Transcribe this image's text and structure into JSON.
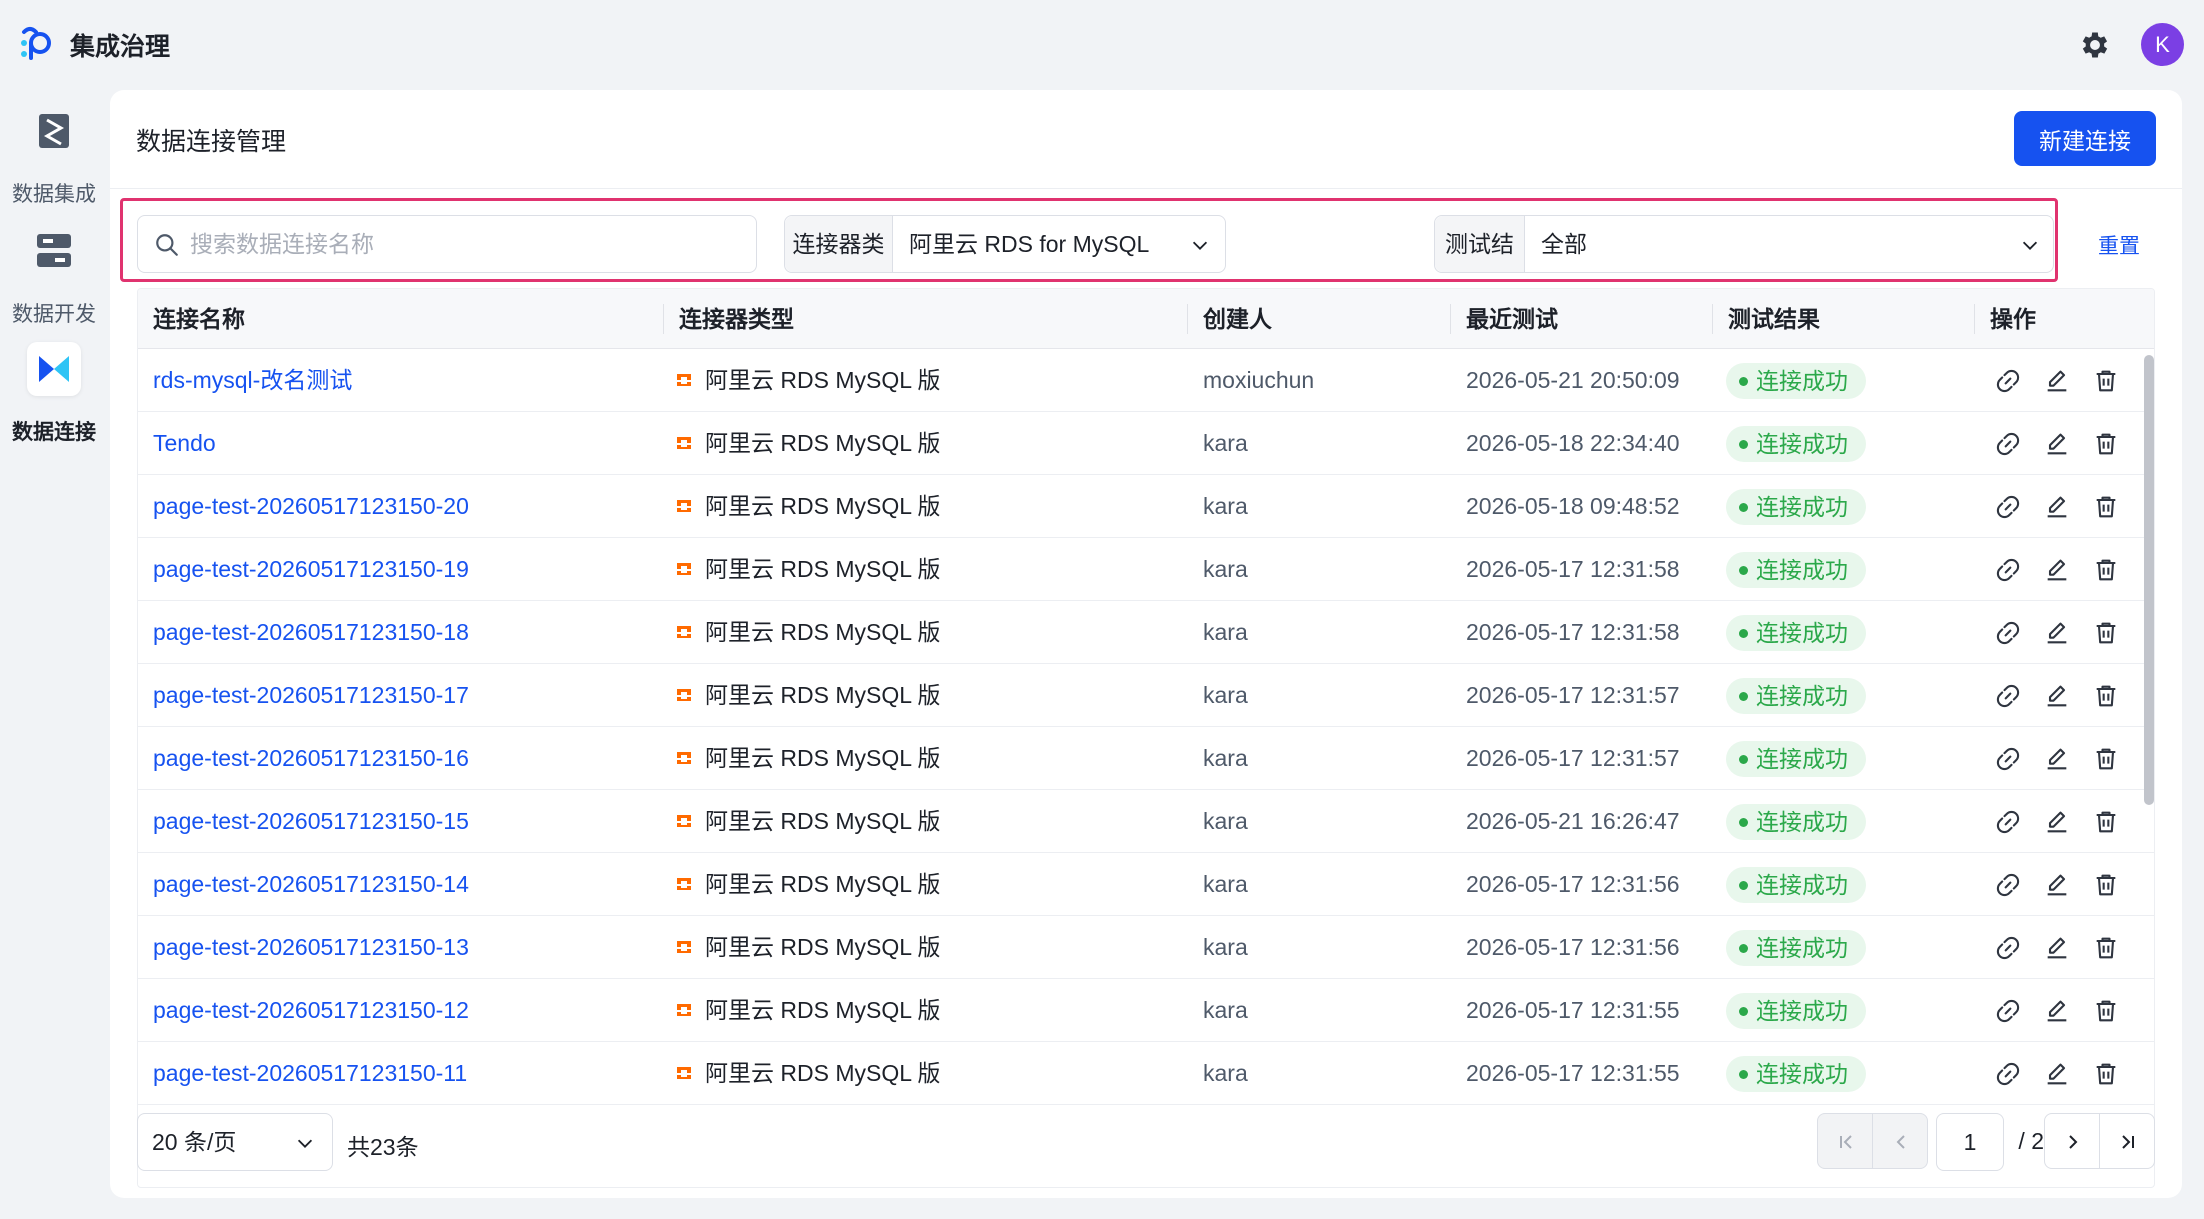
{
  "app": {
    "title": "集成治理",
    "avatar_letter": "K"
  },
  "sidebar": {
    "items": [
      {
        "label": "数据集成",
        "icon": "data-integration-icon"
      },
      {
        "label": "数据开发",
        "icon": "data-development-icon"
      },
      {
        "label": "数据连接",
        "icon": "data-connection-icon",
        "active": true
      }
    ]
  },
  "page": {
    "title": "数据连接管理",
    "new_button": "新建连接"
  },
  "filters": {
    "search_placeholder": "搜索数据连接名称",
    "connector_type_label": "连接器类型",
    "connector_type_value": "阿里云 RDS for MySQL",
    "test_result_label": "测试结果",
    "test_result_value": "全部",
    "reset": "重置"
  },
  "table": {
    "headers": [
      "连接名称",
      "连接器类型",
      "创建人",
      "最近测试",
      "测试结果",
      "操作"
    ],
    "rows": [
      {
        "name": "rds-mysql-改名测试",
        "type": "阿里云 RDS MySQL 版",
        "creator": "moxiuchun",
        "tested": "2026-05-21 20:50:09",
        "result": "连接成功"
      },
      {
        "name": "Tendo",
        "type": "阿里云 RDS MySQL 版",
        "creator": "kara",
        "tested": "2026-05-18 22:34:40",
        "result": "连接成功"
      },
      {
        "name": "page-test-20260517123150-20",
        "type": "阿里云 RDS MySQL 版",
        "creator": "kara",
        "tested": "2026-05-18 09:48:52",
        "result": "连接成功"
      },
      {
        "name": "page-test-20260517123150-19",
        "type": "阿里云 RDS MySQL 版",
        "creator": "kara",
        "tested": "2026-05-17 12:31:58",
        "result": "连接成功"
      },
      {
        "name": "page-test-20260517123150-18",
        "type": "阿里云 RDS MySQL 版",
        "creator": "kara",
        "tested": "2026-05-17 12:31:58",
        "result": "连接成功"
      },
      {
        "name": "page-test-20260517123150-17",
        "type": "阿里云 RDS MySQL 版",
        "creator": "kara",
        "tested": "2026-05-17 12:31:57",
        "result": "连接成功"
      },
      {
        "name": "page-test-20260517123150-16",
        "type": "阿里云 RDS MySQL 版",
        "creator": "kara",
        "tested": "2026-05-17 12:31:57",
        "result": "连接成功"
      },
      {
        "name": "page-test-20260517123150-15",
        "type": "阿里云 RDS MySQL 版",
        "creator": "kara",
        "tested": "2026-05-21 16:26:47",
        "result": "连接成功"
      },
      {
        "name": "page-test-20260517123150-14",
        "type": "阿里云 RDS MySQL 版",
        "creator": "kara",
        "tested": "2026-05-17 12:31:56",
        "result": "连接成功"
      },
      {
        "name": "page-test-20260517123150-13",
        "type": "阿里云 RDS MySQL 版",
        "creator": "kara",
        "tested": "2026-05-17 12:31:56",
        "result": "连接成功"
      },
      {
        "name": "page-test-20260517123150-12",
        "type": "阿里云 RDS MySQL 版",
        "creator": "kara",
        "tested": "2026-05-17 12:31:55",
        "result": "连接成功"
      },
      {
        "name": "page-test-20260517123150-11",
        "type": "阿里云 RDS MySQL 版",
        "creator": "kara",
        "tested": "2026-05-17 12:31:55",
        "result": "连接成功"
      }
    ],
    "row_actions": [
      "link-icon",
      "edit-icon",
      "delete-icon"
    ]
  },
  "pagination": {
    "page_size": "20 条/页",
    "total": "共23条",
    "current_page": "1",
    "of_pages": "/ 2"
  },
  "colors": {
    "primary": "#1652f0",
    "success": "#2ba84a",
    "success_bg": "#e8f7ec",
    "filter_highlight": "#e0336f",
    "avatar": "#7b3fe4"
  }
}
